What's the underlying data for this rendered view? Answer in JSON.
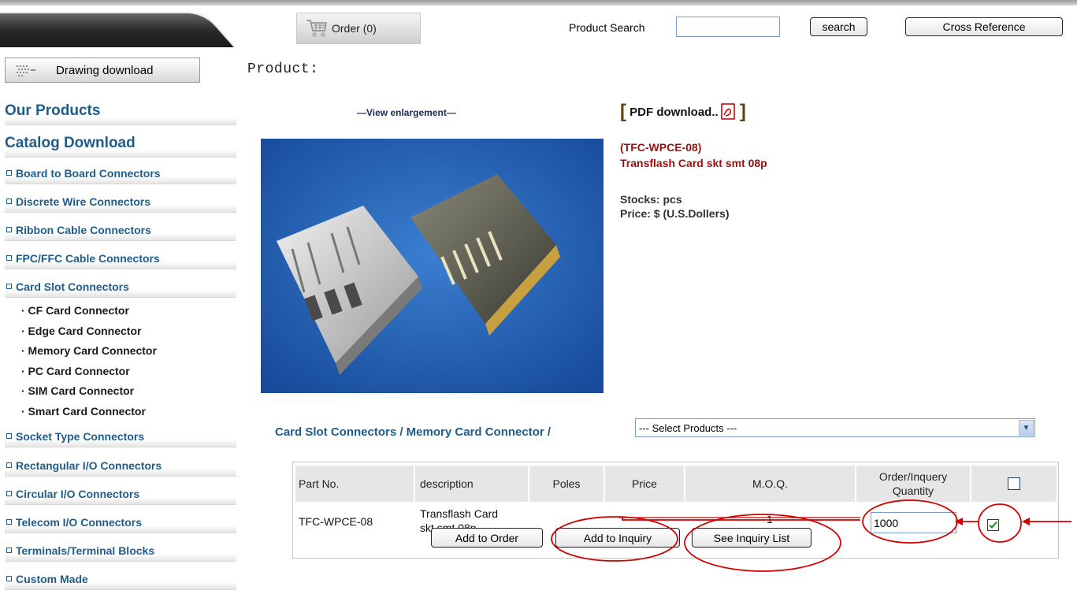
{
  "header": {
    "order_label": "Order",
    "order_count": "(0)",
    "search_label": "Product Search",
    "search_value": "",
    "search_button": "search",
    "cross_reference_button": "Cross Reference"
  },
  "sidebar": {
    "drawing_download": "Drawing download",
    "headings": [
      "Our Products",
      "Catalog Download"
    ],
    "items": [
      {
        "label": "Board to Board Connectors"
      },
      {
        "label": "Discrete Wire Connectors"
      },
      {
        "label": "Ribbon Cable Connectors"
      },
      {
        "label": "FPC/FFC Cable Connectors"
      },
      {
        "label": "Card Slot Connectors"
      },
      {
        "label": "Socket Type Connectors"
      },
      {
        "label": "Rectangular I/O Connectors"
      },
      {
        "label": "Circular I/O Connectors"
      },
      {
        "label": "Telecom I/O Connectors"
      },
      {
        "label": "Terminals/Terminal Blocks"
      },
      {
        "label": "Custom Made"
      }
    ],
    "subitems": [
      "· CF Card Connector",
      "· Edge Card Connector",
      "· Memory Card Connector",
      "· PC Card Connector",
      "· SIM Card Connector",
      "· Smart Card Connector"
    ]
  },
  "product": {
    "page_title": "Product:",
    "view_enlargement": "—View enlargement—",
    "pdf_download": "PDF download..",
    "part_code": "(TFC-WPCE-08)",
    "part_name": "Transflash Card skt smt 08p",
    "stocks": "Stocks: pcs",
    "price": "Price: $ (U.S.Dollers)",
    "breadcrumb": "Card Slot Connectors / Memory Card Connector /",
    "select_value": "--- Select Products ---"
  },
  "table": {
    "headers": [
      "Part No.",
      "description",
      "Poles",
      "Price",
      "M.O.Q.",
      "Order/Inquery",
      "Quantity"
    ],
    "row": {
      "part_no": "TFC-WPCE-08",
      "description_line1": "Transflash Card",
      "description_line2": "skt smt 08p",
      "poles": "",
      "price": "",
      "moq": "1",
      "quantity": "1000",
      "checked": true
    },
    "buttons": [
      "Add to Order",
      "Add to Inquiry",
      "See Inquiry List"
    ]
  },
  "colors": {
    "link_blue": "#1f5c8a",
    "part_red": "#9a1010",
    "annotation_red": "#d40000"
  }
}
